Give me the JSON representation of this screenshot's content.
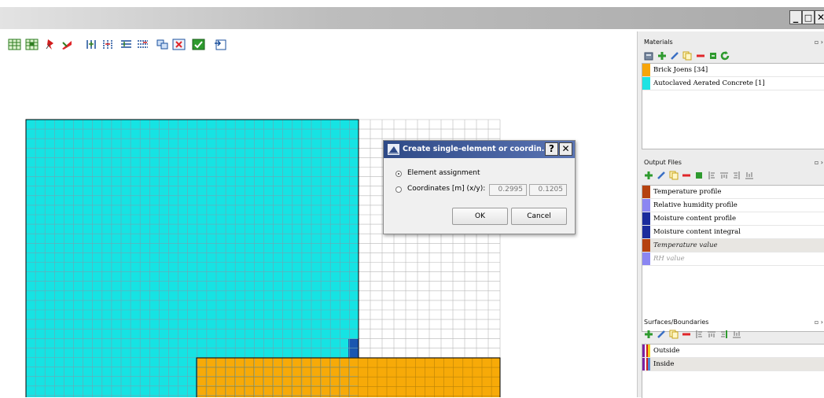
{
  "window": {
    "minimize_label": "_",
    "maximize_label": "□",
    "close_label": "✕"
  },
  "toolbar": {
    "icons": [
      "grid-add-icon",
      "grid-remove-icon",
      "pin-icon",
      "flag-icon",
      "column-insert-icon",
      "column-remove-icon",
      "row-insert-icon",
      "row-remove-icon",
      "merge-icon",
      "delete-icon",
      "check-icon",
      "import-icon"
    ]
  },
  "grid": {
    "cyan_color": "#16e3e3",
    "orange_color": "#f7aa08",
    "darkblue_color": "#1a56b0",
    "line_color": "#6fa6b4"
  },
  "materials_panel": {
    "title": "Materials",
    "items": [
      {
        "label": "Brick Joens [34]",
        "color": "#f7a50a"
      },
      {
        "label": "Autoclaved Aerated Concrete [1]",
        "color": "#1de3e3"
      }
    ]
  },
  "output_panel": {
    "title": "Output Files",
    "items": [
      {
        "label": "Temperature profile",
        "color": "#b5420f",
        "style": "normal"
      },
      {
        "label": "Relative humidity profile",
        "color": "#8b86f2",
        "style": "normal"
      },
      {
        "label": "Moisture content profile",
        "color": "#1b2c9c",
        "style": "normal"
      },
      {
        "label": "Moisture content integral",
        "color": "#1b2c9c",
        "style": "normal"
      },
      {
        "label": "Temperature value",
        "color": "#b5420f",
        "style": "italic"
      },
      {
        "label": "RH value",
        "color": "#8b86f2",
        "style": "dim"
      }
    ]
  },
  "surfaces_panel": {
    "title": "Surfaces/Boundaries",
    "items": [
      {
        "label": "Outside"
      },
      {
        "label": "Inside"
      }
    ]
  },
  "dialog": {
    "title": "Create single-element or coordin...",
    "help_label": "?",
    "close_label": "✕",
    "option_element": "Element assignment",
    "option_coords": "Coordinates [m] (x/y):",
    "x_value": "0.2995",
    "y_value": "0.1205",
    "ok_label": "OK",
    "cancel_label": "Cancel"
  }
}
